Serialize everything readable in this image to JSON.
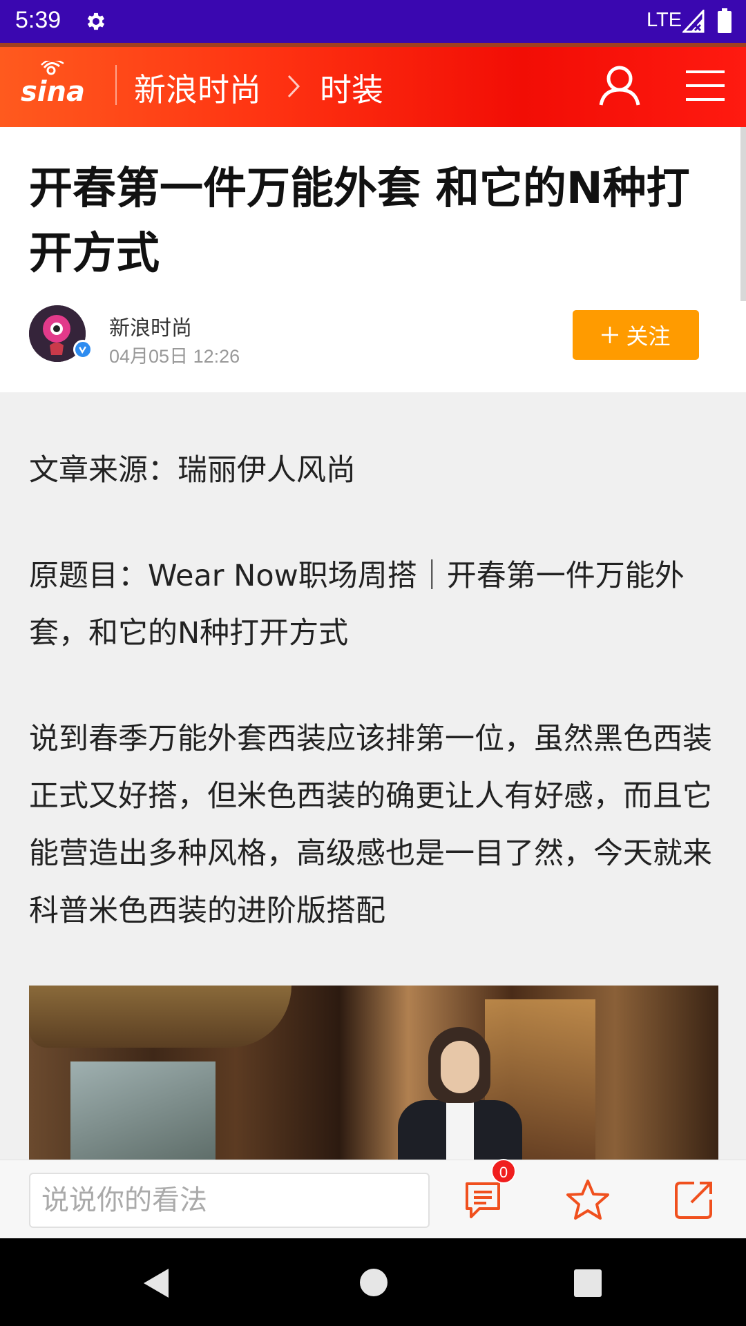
{
  "status_bar": {
    "time": "5:39",
    "network": "LTE",
    "icons": [
      "gear-icon",
      "signal-icon",
      "battery-icon"
    ]
  },
  "header": {
    "logo_text": "sina",
    "channel": "新浪时尚",
    "section": "时装",
    "icons": [
      "user-icon",
      "menu-icon",
      "chevron-right-icon"
    ],
    "colors": {
      "gradient_start": "#ff5a1e",
      "gradient_end": "#f20d05"
    }
  },
  "article": {
    "title": "开春第一件万能外套 和它的N种打开方式",
    "author": "新浪时尚",
    "published": "04月05日   12:26",
    "follow_label": "关注",
    "paragraphs": [
      "文章来源：瑞丽伊人风尚",
      "原题目：Wear Now职场周搭｜开春第一件万能外套，和它的N种打开方式",
      "说到春季万能外套西装应该排第一位，虽然黑色西装正式又好搭，但米色西装的确更让人有好感，而且它能营造出多种风格，高级感也是一目了然，今天就来科普米色西装的进阶版搭配"
    ],
    "colors": {
      "follow": "#ff9b00",
      "verified": "#2d8cf0"
    }
  },
  "comment_bar": {
    "placeholder": "说说你的看法",
    "comment_count": "0",
    "icons": [
      "comments-icon",
      "star-icon",
      "share-icon"
    ],
    "accent": "#f0501e"
  },
  "nav_bar": {
    "icons": [
      "back-icon",
      "home-icon",
      "recents-icon"
    ]
  }
}
